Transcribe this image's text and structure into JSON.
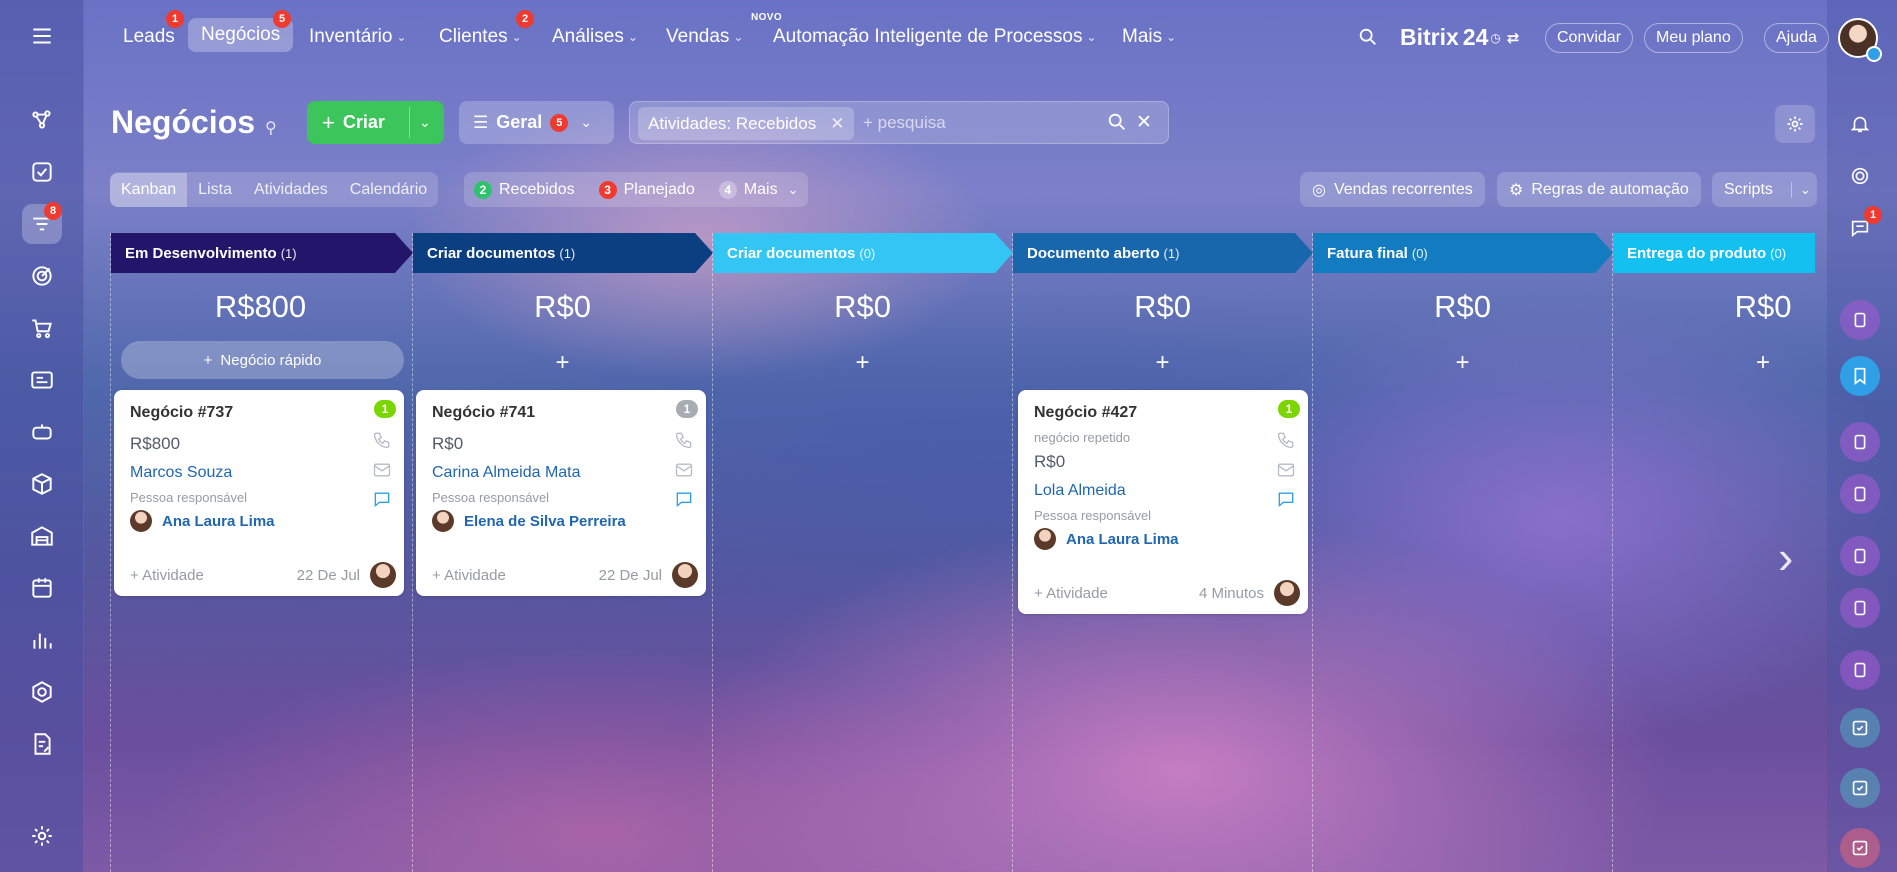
{
  "topnav": {
    "items": [
      {
        "label": "Leads",
        "badge": "1"
      },
      {
        "label": "Negócios",
        "badge": "5"
      },
      {
        "label": "Inventário"
      },
      {
        "label": "Clientes",
        "badge": "2"
      },
      {
        "label": "Análises"
      },
      {
        "label": "Vendas",
        "tag": "NOVO"
      },
      {
        "label": "Automação Inteligente de Processos"
      },
      {
        "label": "Mais"
      }
    ],
    "brand": "Bitrix",
    "brand_num": "24",
    "invite": "Convidar",
    "plan": "Meu plano",
    "help": "Ajuda"
  },
  "leftbar": {
    "deals_badge": "8"
  },
  "rightbar": {
    "chat_badge": "1"
  },
  "page": {
    "title": "Negócios",
    "create": "Criar",
    "filter_label": "Geral",
    "filter_badge": "5",
    "search_chip": "Atividades: Recebidos",
    "search_placeholder": "+ pesquisa"
  },
  "views": [
    "Kanban",
    "Lista",
    "Atividades",
    "Calendário"
  ],
  "counters": [
    {
      "n": "2",
      "label": "Recebidos",
      "color": "#2fc26e"
    },
    {
      "n": "3",
      "label": "Planejado",
      "color": "#ef3b2f"
    },
    {
      "n": "4",
      "label": "Mais",
      "color": "#a8adb4"
    }
  ],
  "toolbar_right": {
    "recurring": "Vendas recorrentes",
    "automation": "Regras de automação",
    "scripts": "Scripts"
  },
  "columns": [
    {
      "title": "Em Desenvolvimento",
      "count": "(1)",
      "sum": "R$800",
      "color": "#23156a",
      "quick": "Negócio rápido"
    },
    {
      "title": "Criar documentos",
      "count": "(1)",
      "sum": "R$0",
      "color": "#0c3f82"
    },
    {
      "title": "Criar documentos",
      "count": "(0)",
      "sum": "R$0",
      "color": "#33c5f3"
    },
    {
      "title": "Documento aberto",
      "count": "(1)",
      "sum": "R$0",
      "color": "#1866ab"
    },
    {
      "title": "Fatura final",
      "count": "(0)",
      "sum": "R$0",
      "color": "#137cc1"
    },
    {
      "title": "Entrega do produto",
      "count": "(0)",
      "sum": "R$0",
      "color": "#14c0ef"
    }
  ],
  "cards": [
    {
      "name": "Negócio #737",
      "num": "1",
      "num_color": "#7bd500",
      "amount": "R$800",
      "client": "Marcos Souza",
      "resp_label": "Pessoa responsável",
      "resp": "Ana Laura Lima",
      "activity": "+ Atividade",
      "date": "22 De Jul"
    },
    {
      "name": "Negócio #741",
      "num": "1",
      "num_color": "#a8adb4",
      "amount": "R$0",
      "client": "Carina Almeida Mata",
      "resp_label": "Pessoa responsável",
      "resp": "Elena de Silva Perreira",
      "activity": "+ Atividade",
      "date": "22 De Jul"
    },
    {
      "name": "Negócio #427",
      "num": "1",
      "num_color": "#7bd500",
      "sub": "negócio repetido",
      "amount": "R$0",
      "client": "Lola Almeida",
      "resp_label": "Pessoa responsável",
      "resp": "Ana Laura Lima",
      "activity": "+ Atividade",
      "date": "4 Minutos"
    }
  ]
}
